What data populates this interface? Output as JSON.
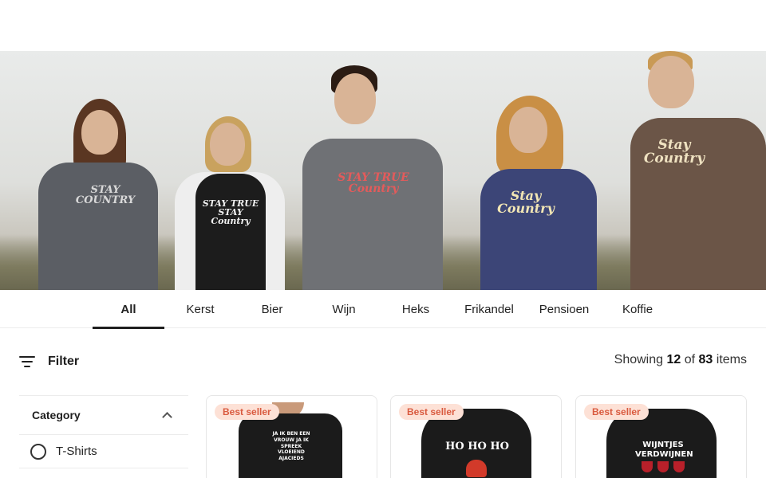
{
  "hero": {
    "prints": [
      "STAY COUNTRY",
      "STAY TRUE STAY Country",
      "STAY TRUE Country",
      "Stay Country",
      "Stay Country"
    ]
  },
  "tabs": [
    {
      "label": "All",
      "active": true
    },
    {
      "label": "Kerst"
    },
    {
      "label": "Bier"
    },
    {
      "label": "Wijn"
    },
    {
      "label": "Heks"
    },
    {
      "label": "Frikandel"
    },
    {
      "label": "Pensioen"
    },
    {
      "label": "Koffie"
    }
  ],
  "filter": {
    "label": "Filter",
    "icon": "filter-icon"
  },
  "results": {
    "prefix": "Showing",
    "shown": "12",
    "middle": "of",
    "total": "83",
    "suffix": "items"
  },
  "category": {
    "title": "Category",
    "options": [
      "T-Shirts"
    ]
  },
  "products": [
    {
      "badge": "Best seller",
      "print": "JA IK BEN EEN VROUW JA IK SPREEK VLOEIEND AJACIEDS"
    },
    {
      "badge": "Best seller",
      "print": "HO HO HO"
    },
    {
      "badge": "Best seller",
      "print": "WIJNTJES VERDWIJNEN"
    }
  ],
  "colors": {
    "badge_bg": "#fde1d6",
    "badge_text": "#d95a3f",
    "active_tab_underline": "#1f1f1f"
  }
}
